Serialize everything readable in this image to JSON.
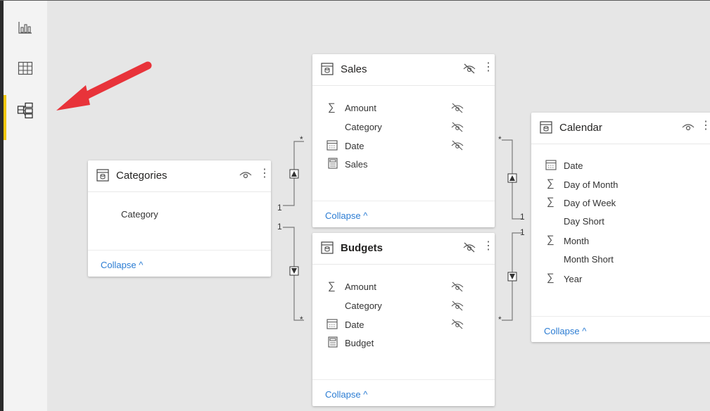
{
  "tables": {
    "sales": {
      "title": "Sales",
      "fields": [
        "Amount",
        "Category",
        "Date",
        "Sales"
      ],
      "collapse": "Collapse ^"
    },
    "categories": {
      "title": "Categories",
      "fields": [
        "Category"
      ],
      "collapse": "Collapse ^"
    },
    "budgets": {
      "title": "Budgets",
      "fields": [
        "Amount",
        "Category",
        "Date",
        "Budget"
      ],
      "collapse": "Collapse ^"
    },
    "calendar": {
      "title": "Calendar",
      "fields": [
        "Date",
        "Day of Month",
        "Day of Week",
        "Day Short",
        "Month",
        "Month Short",
        "Year"
      ],
      "collapse": "Collapse ^"
    }
  },
  "relationships": {
    "one": "1",
    "many": "*"
  },
  "colors": {
    "accent": "#f2c811",
    "link": "#2b7cd3",
    "arrow": "#e8333a"
  }
}
